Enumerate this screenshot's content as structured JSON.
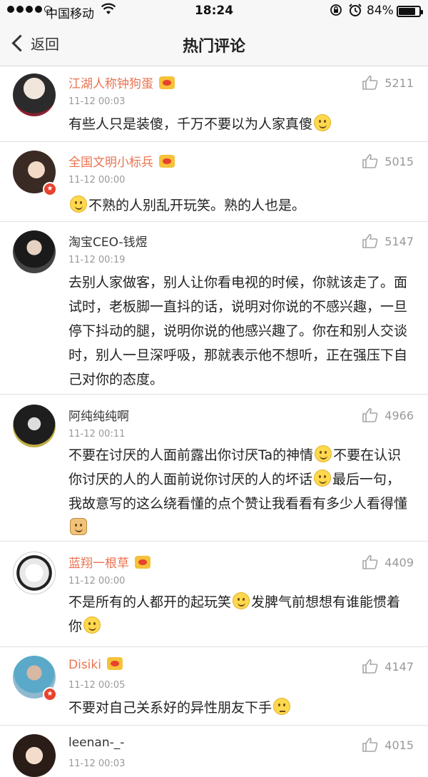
{
  "status_bar": {
    "carrier": "中国移动",
    "time": "18:24",
    "battery_percent_text": "84%",
    "battery_level": 0.84
  },
  "nav": {
    "back_label": "返回",
    "title": "热门评论"
  },
  "comments": [
    {
      "name": "江湖人称钟狗蛋",
      "time": "11-12 00:03",
      "likes": "5211",
      "text_parts": [
        "有些人只是装傻，千万不要以为人家真傻"
      ],
      "emojis": [
        "smile"
      ]
    },
    {
      "name": "全国文明小标兵",
      "time": "11-12 00:00",
      "likes": "5015",
      "text_parts": [
        "不熟的人别乱开玩笑。熟的人也是。"
      ]
    },
    {
      "name": "淘宝CEO-钱煜",
      "time": "11-12 00:19",
      "likes": "5147",
      "text_parts": [
        "去别人家做客，别人让你看电视的时候，你就该走了。面试时，老板脚一直抖的话，说明对你说的不感兴趣，一旦停下抖动的腿，说明你说的他感兴趣了。你在和别人交谈时，别人一旦深呼吸，那就表示他不想听，正在强压下自己对你的态度。"
      ]
    },
    {
      "name": "阿纯纯纯啊",
      "time": "11-12 00:11",
      "likes": "4966",
      "text_parts": [
        "不要在讨厌的人面前露出你讨厌Ta的神情",
        "不要在认识你讨厌的人的人面前说你讨厌的人的坏话",
        "最后一句，我故意写的这么绕看懂的点个赞让我看看有多少人看得懂"
      ]
    },
    {
      "name": "蓝翔一根草",
      "time": "11-12 00:00",
      "likes": "4409",
      "text_parts": [
        "不是所有的人都开的起玩笑",
        "发脾气前想想有谁能惯着你"
      ]
    },
    {
      "name": "Disiki",
      "time": "11-12 00:05",
      "likes": "4147",
      "text_parts": [
        "不要对自己关系好的异性朋友下手"
      ]
    },
    {
      "name": "leenan-_-",
      "time": "11-12 00:03",
      "likes": "4015",
      "text_parts": [
        ""
      ]
    }
  ]
}
